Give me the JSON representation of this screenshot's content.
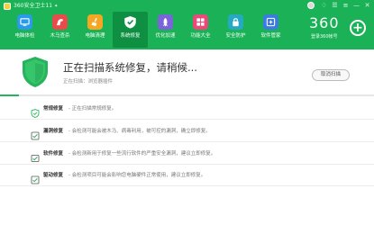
{
  "app": {
    "title": "360安全卫士11",
    "upgrade_mark": "✦"
  },
  "window_controls": {
    "skin": "♢",
    "feedback": "☰",
    "menu": "≡",
    "minimize": "—",
    "close": "✕"
  },
  "nav": {
    "items": [
      {
        "label": "电脑体检",
        "icon": "monitor-icon",
        "color": "#2a9be8"
      },
      {
        "label": "木马查杀",
        "icon": "horse-icon",
        "color": "#e94a4a"
      },
      {
        "label": "电脑清理",
        "icon": "broom-icon",
        "color": "#f5a623"
      },
      {
        "label": "系统修复",
        "icon": "shield-check-icon",
        "color": "#1bb257",
        "active": true
      },
      {
        "label": "优化加速",
        "icon": "rocket-icon",
        "color": "#7b63d9"
      },
      {
        "label": "功能大全",
        "icon": "grid-icon",
        "color": "#e94a7a"
      },
      {
        "label": "安全防护",
        "icon": "lock-icon",
        "color": "#27a9c4"
      },
      {
        "label": "软件管家",
        "icon": "apps-icon",
        "color": "#3c7be0"
      }
    ]
  },
  "brand": {
    "number": "360",
    "subtitle": "登录360帐号"
  },
  "status": {
    "title": "正在扫描系统修复，请稍候...",
    "subtitle": "正在扫描：浏览器插件",
    "cancel_label": "取消扫描",
    "progress_fraction": 0.05
  },
  "repairs": [
    {
      "name": "常规修复",
      "desc": "- 正在扫描常规修复。",
      "icon": "shield-scan-icon"
    },
    {
      "name": "漏洞修复",
      "desc": "- 会检测可能会被木马、病毒利用，被可控的漏洞，确立即修复。",
      "icon": "bug-icon"
    },
    {
      "name": "软件修复",
      "desc": "- 会检测新用于修复一些流行软件的严重安全漏洞，建议立即修复。",
      "icon": "software-icon"
    },
    {
      "name": "驱动修复",
      "desc": "- 会检测项目可能会影响您电脑硬件正常使用，建议立即修复。",
      "icon": "driver-icon"
    }
  ],
  "colors": {
    "header": "#1bb257",
    "accent": "#27b35b"
  }
}
